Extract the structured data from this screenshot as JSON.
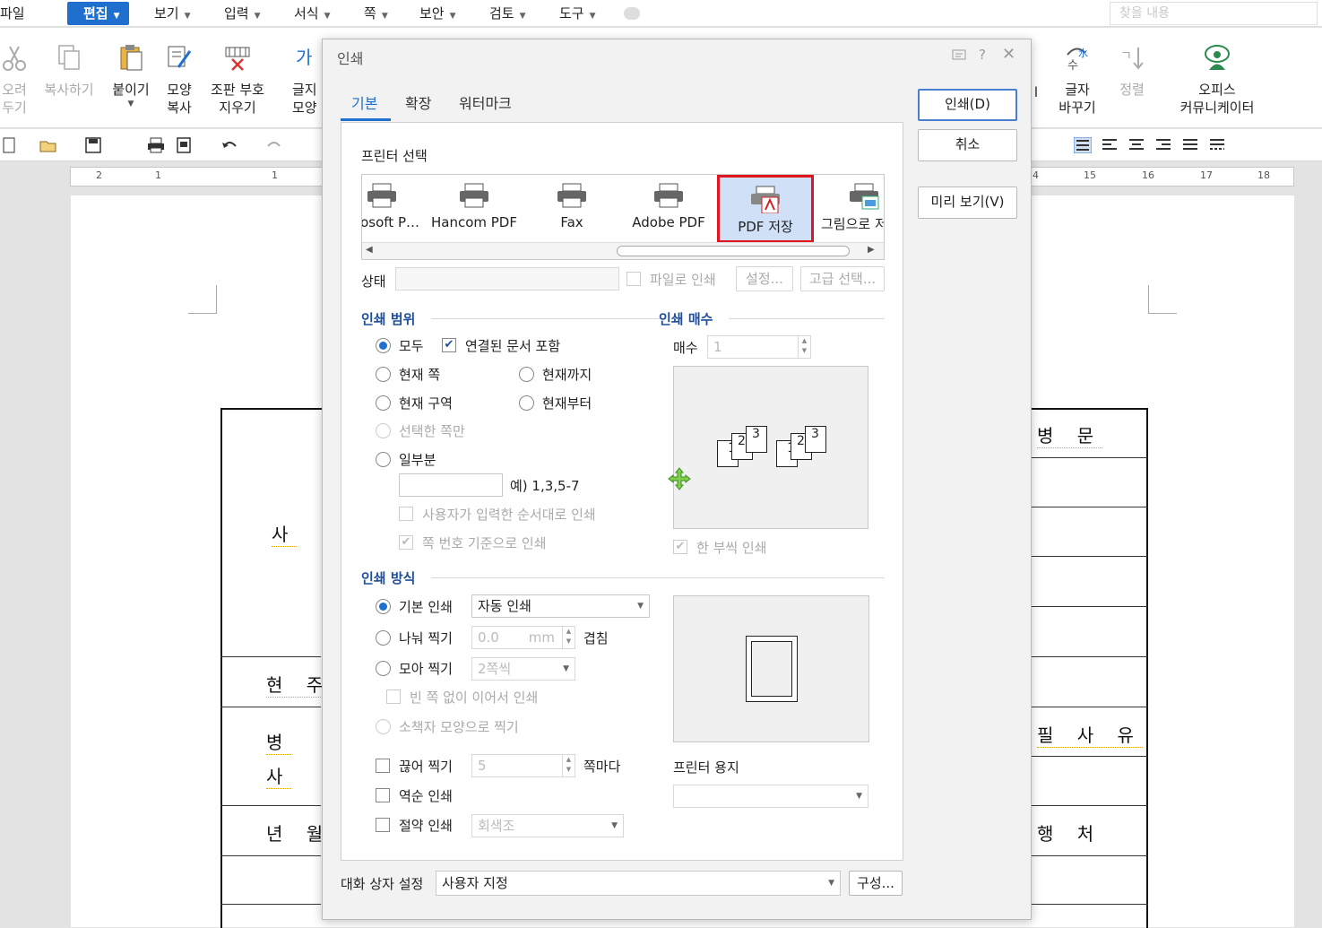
{
  "menubar": {
    "items": [
      {
        "label": "파일"
      },
      {
        "label": "편집"
      },
      {
        "label": "보기"
      },
      {
        "label": "입력"
      },
      {
        "label": "서식"
      },
      {
        "label": "쪽"
      },
      {
        "label": "보안"
      },
      {
        "label": "검토"
      },
      {
        "label": "도구"
      }
    ],
    "search_placeholder": "찾을 내용"
  },
  "ribbon": {
    "cut": "오려\n두기",
    "copy": "복사하기",
    "paste": "붙이기",
    "format_copy": "모양\n복사",
    "erase_codes": "조판 부호\n지우기",
    "char_shape": "글지\n모양",
    "change_char": "글자\n바꾸기",
    "sort": "정렬",
    "office_comm": "오피스\n커뮤니케이터",
    "bar": "l"
  },
  "ruler": {
    "nums": [
      "2",
      "1",
      "1",
      "4",
      "15",
      "16",
      "17",
      "18"
    ]
  },
  "document": {
    "cells": [
      "사",
      "현 주",
      "병",
      "사",
      "년 월",
      "병 문",
      "필 사 유",
      "행 처"
    ]
  },
  "dialog": {
    "title": "인쇄",
    "tabs": [
      "기본",
      "확장",
      "워터마크"
    ],
    "buttons": {
      "print": "인쇄(D)",
      "cancel": "취소",
      "preview": "미리 보기(V)",
      "configure": "구성..."
    },
    "printer_section": "프린터 선택",
    "printers": [
      {
        "label": "osoft P…"
      },
      {
        "label": "Hancom PDF"
      },
      {
        "label": "Fax"
      },
      {
        "label": "Adobe PDF"
      },
      {
        "label": "PDF 저장"
      },
      {
        "label": "그림으로 저"
      }
    ],
    "selected_printer": "PDF 저장",
    "status_label": "상태",
    "status_value": "",
    "print_to_file": "파일로 인쇄",
    "settings_btn": "설정...",
    "advanced_btn": "고급 선택...",
    "range": {
      "title": "인쇄 범위",
      "all": "모두",
      "linked": "연결된 문서 포함",
      "current_page": "현재 쪽",
      "to_current": "현재까지",
      "current_section": "현재 구역",
      "from_current": "현재부터",
      "selected_pages": "선택한 쪽만",
      "partial": "일부분",
      "partial_hint": "예) 1,3,5-7",
      "user_order": "사용자가 입력한 순서대로 인쇄",
      "page_number_basis": "쪽 번호 기준으로 인쇄"
    },
    "copies": {
      "title": "인쇄 매수",
      "label": "매수",
      "value": "1",
      "collate": "한 부씩 인쇄",
      "sheet_nums": [
        "1",
        "2",
        "3",
        "1",
        "2",
        "3"
      ]
    },
    "method": {
      "title": "인쇄 방식",
      "basic": "기본 인쇄",
      "basic_value": "자동 인쇄",
      "split": "나눠 찍기",
      "split_value": "0.0",
      "split_unit": "mm",
      "overlap": "겹침",
      "gather": "모아 찍기",
      "gather_value": "2쪽씩",
      "no_blank": "빈 쪽 없이 이어서 인쇄",
      "booklet": "소책자 모양으로 찍기",
      "cut": "끊어 찍기",
      "cut_value": "5",
      "per_page": "쪽마다",
      "reverse": "역순 인쇄",
      "save": "절약 인쇄",
      "save_value": "회색조",
      "paper_label": "프린터 용지",
      "paper_value": ""
    },
    "dialog_setting_label": "대화 상자 설정",
    "dialog_setting_value": "사용자 지정"
  }
}
